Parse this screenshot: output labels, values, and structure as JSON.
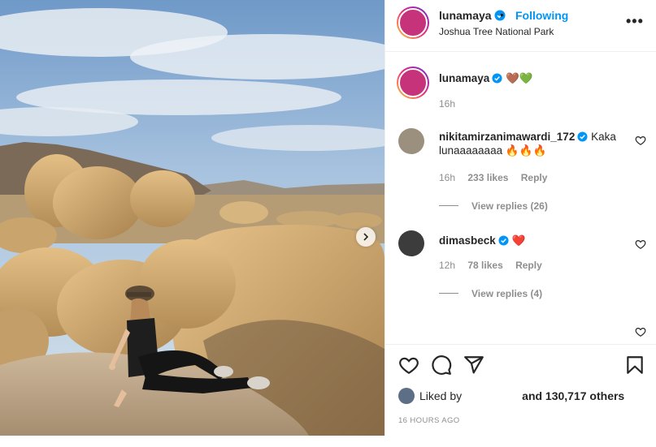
{
  "post": {
    "author": "lunamaya",
    "follow_separator": "•",
    "follow_label": "Following",
    "location": "Joshua Tree National Park",
    "more_glyph": "•••",
    "caption_text": "🤎💚",
    "caption_time": "16h"
  },
  "comments": [
    {
      "username": "nikitamirzanimawardi_172",
      "text": "Kaka lunaaaaaaaa 🔥🔥🔥",
      "time": "16h",
      "likes": "233 likes",
      "reply_label": "Reply",
      "view_replies": "View replies (26)"
    },
    {
      "username": "dimasbeck",
      "text": "❤️",
      "time": "12h",
      "likes": "78 likes",
      "reply_label": "Reply",
      "view_replies": "View replies (4)"
    }
  ],
  "footer": {
    "liked_by_prefix": "Liked by",
    "liked_by_suffix": "and 130,717 others",
    "timestamp": "16 HOURS AGO"
  },
  "colors": {
    "accent": "#0095f6",
    "verified": "#0095f6",
    "muted": "#8e8e8e"
  },
  "icons": [
    "verified-badge-icon",
    "more-options-icon",
    "heart-icon",
    "comment-icon",
    "share-icon",
    "bookmark-icon",
    "chevron-right-icon"
  ]
}
